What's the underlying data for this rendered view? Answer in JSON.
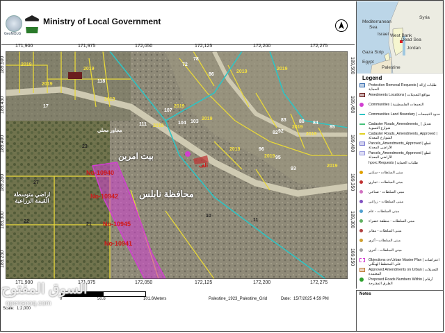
{
  "header": {
    "title": "Ministry of Local Government",
    "logo_text": "GeoMOLG",
    "north_arrow": "north-arrow-icon"
  },
  "inset_map": {
    "labels": [
      "Syria",
      "Mediterranean",
      "Sea",
      "Israel",
      "West Bank",
      "Dead Sea",
      "Gaza Strip",
      "Jordan",
      "Egypt",
      "Palestine"
    ]
  },
  "grid": {
    "top_x": [
      "171,900",
      "171,975",
      "172,050",
      "172,125",
      "172,200",
      "172,275"
    ],
    "bottom_x": [
      "171,900",
      "171,975",
      "172,050",
      "172,125",
      "172,200",
      "172,275"
    ],
    "left_y": [
      "189,500",
      "189,450",
      "189,400",
      "189,350",
      "189,300",
      "189,250"
    ],
    "right_y": [
      "189,500",
      "189,450",
      "189,400",
      "189,350",
      "189,300",
      "189,250"
    ]
  },
  "map_labels": {
    "years": [
      "2019",
      "2019",
      "2019",
      "2019",
      "2019",
      "2019",
      "2019",
      "2019",
      "2019",
      "2019",
      "2019",
      "2019",
      "2019",
      "2019"
    ],
    "parcel_numbers": [
      "118",
      "111",
      "17",
      "72",
      "78",
      "86",
      "107",
      "104",
      "103",
      "96",
      "93",
      "95",
      "92",
      "88",
      "82",
      "83",
      "84",
      "85",
      "27",
      "23",
      "22",
      "21",
      "11",
      "10",
      "No-10940",
      "No-10942",
      "No-10945",
      "No-10941"
    ],
    "arabic_place": "محافظة نابلس",
    "arabic_village": "بيت امرين",
    "arabic_zone": "اراضي متوسطة القيمة الزراعية",
    "road_label": "مجاور محلي",
    "red_label": "الف"
  },
  "legend": {
    "title": "Legend",
    "items": [
      {
        "symbol": "square",
        "color": "#3a6fb0",
        "label": "Protection Removal Requests | طلبات إزالة الحماية"
      },
      {
        "symbol": "square",
        "color": "#6a1e1e",
        "label": "Amedments Locations | مواقع التعديلات"
      },
      {
        "symbol": "circle",
        "color": "#d13fd1",
        "label": "Communities | التجمعات الفلسطينية"
      },
      {
        "symbol": "line",
        "color": "#2ec4c4",
        "label": "Communities Land Boundary | حدود التجمعات"
      },
      {
        "symbol": "line",
        "color": "#46c07a",
        "label": "Cadaster Roads_Amendments_ | تعديل شوارع التسوية"
      },
      {
        "symbol": "line",
        "color": "#e0d020",
        "label": "Cadaster Roads_Amendments_Approved | الشوارع المعدلة"
      },
      {
        "symbol": "square",
        "color": "#7a7ad0",
        "label": "Parcels_Amendments_Approved | قطع الأراضي المعدلة"
      },
      {
        "symbol": "square",
        "color": "#9999dd",
        "label": "Parcels_Amendments_Approved | قطع الأراضي المعدلة"
      },
      {
        "symbol": "text",
        "color": "#111111",
        "label": "hporc Requests | طلبات الحماية"
      },
      {
        "symbol": "dot",
        "color": "#e0a000",
        "label": "مبنى السلطات - سكني"
      },
      {
        "symbol": "dot",
        "color": "#c03030",
        "label": "مبنى السلطات - تجاري"
      },
      {
        "symbol": "dot",
        "color": "#d070c0",
        "label": "مبنى السلطات - صناعي"
      },
      {
        "symbol": "dot",
        "color": "#8050c0",
        "label": "مبنى السلطات - زراعي"
      },
      {
        "symbol": "dot",
        "color": "#50a0d0",
        "label": "مبنى السلطات - عام"
      },
      {
        "symbol": "dot",
        "color": "#60b060",
        "label": "مبنى السلطات - منطقة خضراء"
      },
      {
        "symbol": "dot",
        "color": "#b04040",
        "label": "مبنى السلطات - مقابر"
      },
      {
        "symbol": "dot",
        "color": "#d0a030",
        "label": "مبنى السلطات - أثري"
      },
      {
        "symbol": "dot",
        "color": "#a0a0a0",
        "label": "مبنى السلطات - أخرى"
      },
      {
        "symbol": "dashed",
        "color": "#d13fd1",
        "label": "Objections on Urban Master Plan | اعتراضات على المخطط الهيكلي"
      },
      {
        "symbol": "square",
        "color": "#c08040",
        "label": "Approved Amendments on Urban | التعديلات المعتمدة"
      },
      {
        "symbol": "circle",
        "color": "#2ea02e",
        "label": "Proposed Roads Numbers Within | أرقام الطرق المقترحة"
      }
    ]
  },
  "footer": {
    "scale_bar_values": [
      "0",
      "50.8",
      "101.6Meters"
    ],
    "scale_text": "Scale:",
    "scale_value": "1:2,000",
    "grid_name": "Palestine_1923_Palestine_Grid",
    "date_label": "Date:",
    "date_value": "15/7/2025 4:59 PM",
    "notes_label": "Notes",
    "watermark": "السوق المفتوح",
    "watermark_url": "opensooq.com"
  },
  "colors": {
    "parcel_lines": "#e8d838",
    "boundary": "#2ec4c4",
    "amendments": "#d13fd1",
    "labels": "#d01818"
  }
}
